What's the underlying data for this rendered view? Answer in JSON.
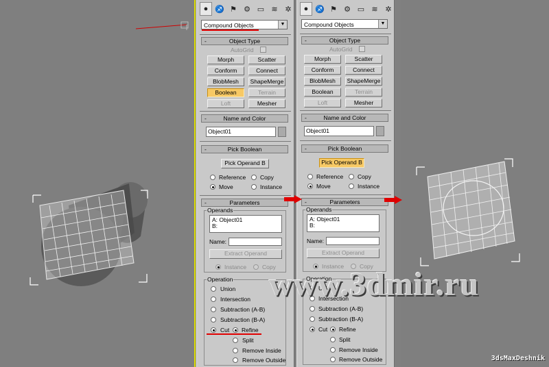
{
  "panels": [
    {
      "tabs": [
        "sphere-icon",
        "curve-icon",
        "hierarchy-icon",
        "motion-icon",
        "display-icon",
        "utilities-icon",
        "wrench-icon"
      ],
      "dropdown": "Compound Objects",
      "object_type": {
        "title": "Object Type",
        "autogrid": "AutoGrid",
        "buttons": [
          "Morph",
          "Scatter",
          "Conform",
          "Connect",
          "BlobMesh",
          "ShapeMerge",
          "Boolean",
          "Terrain",
          "Loft",
          "Mesher"
        ]
      },
      "name_color": {
        "title": "Name and Color",
        "name": "Object01"
      },
      "pick_boolean": {
        "title": "Pick Boolean",
        "button": "Pick Operand B",
        "opts": [
          "Reference",
          "Copy",
          "Move",
          "Instance"
        ]
      },
      "parameters": {
        "title": "Parameters",
        "operands_label": "Operands",
        "operand_a": "A: Object01",
        "operand_b": "B:",
        "name_label": "Name:",
        "extract": "Extract Operand",
        "instance": "Instance",
        "copy": "Copy",
        "operation_label": "Operation",
        "ops": [
          "Union",
          "Intersection",
          "Subtraction (A-B)",
          "Subtraction (B-A)"
        ],
        "cut": "Cut",
        "refine": "Refine",
        "cut_opts": [
          "Split",
          "Remove Inside",
          "Remove Outside"
        ]
      }
    },
    {
      "tabs": [
        "sphere-icon",
        "curve-icon",
        "hierarchy-icon",
        "motion-icon",
        "display-icon",
        "utilities-icon",
        "wrench-icon"
      ],
      "dropdown": "Compound Objects",
      "object_type": {
        "title": "Object Type",
        "autogrid": "AutoGrid",
        "buttons": [
          "Morph",
          "Scatter",
          "Conform",
          "Connect",
          "BlobMesh",
          "ShapeMerge",
          "Boolean",
          "Terrain",
          "Loft",
          "Mesher"
        ]
      },
      "name_color": {
        "title": "Name and Color",
        "name": "Object01"
      },
      "pick_boolean": {
        "title": "Pick Boolean",
        "button": "Pick Operand B",
        "opts": [
          "Reference",
          "Copy",
          "Move",
          "Instance"
        ]
      },
      "parameters": {
        "title": "Parameters",
        "operands_label": "Operands",
        "operand_a": "A: Object01",
        "operand_b": "B:",
        "name_label": "Name:",
        "extract": "Extract Operand",
        "instance": "Instance",
        "copy": "Copy",
        "operation_label": "Operation",
        "ops": [
          "Union",
          "Intersection",
          "Subtraction (A-B)",
          "Subtraction (B-A)"
        ],
        "cut": "Cut",
        "refine": "Refine",
        "cut_opts": [
          "Split",
          "Remove Inside",
          "Remove Outside"
        ]
      }
    }
  ],
  "watermark": "www.3dmir.ru",
  "signature": "3dsMaxDeshnik",
  "colors": {
    "highlight": "#f7c965",
    "annotation": "#e00000",
    "viewport": "#7f7f7f"
  }
}
